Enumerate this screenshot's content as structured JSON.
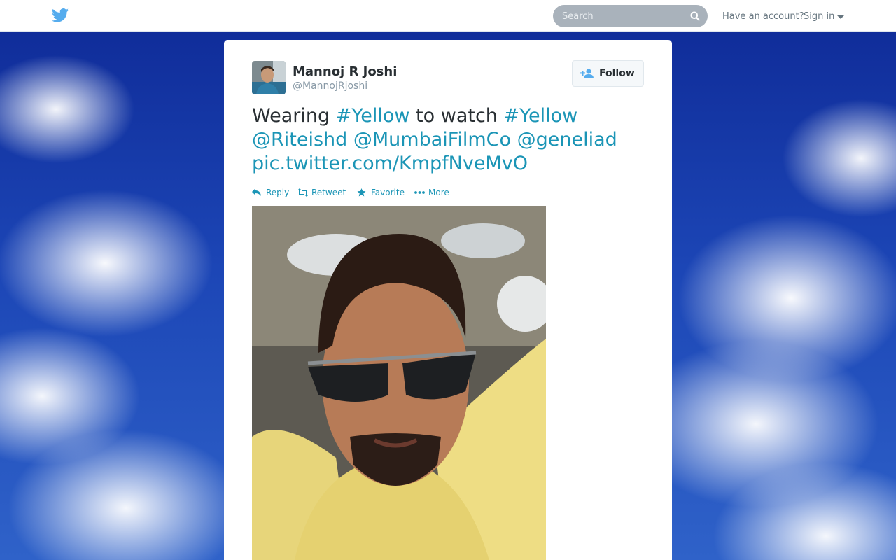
{
  "topbar": {
    "search_placeholder": "Search",
    "have_account": "Have an account?",
    "sign_in": "Sign in"
  },
  "tweet": {
    "author_name": "Mannoj R Joshi",
    "author_handle": "@MannojRjoshi",
    "follow_label": "Follow",
    "text_segments": [
      {
        "text": "Wearing ",
        "link": false
      },
      {
        "text": "#Yellow",
        "link": true
      },
      {
        "text": " to watch ",
        "link": false
      },
      {
        "text": "#Yellow",
        "link": true
      },
      {
        "text": " ",
        "link": false
      },
      {
        "text": "@Riteishd",
        "link": true
      },
      {
        "text": " ",
        "link": false
      },
      {
        "text": "@MumbaiFilmCo",
        "link": true
      },
      {
        "text": " ",
        "link": false
      },
      {
        "text": "@geneliad",
        "link": true
      },
      {
        "text": " ",
        "link": false
      },
      {
        "text": "pic.twitter.com/KmpfNveMvO",
        "link": true
      }
    ],
    "actions": {
      "reply": "Reply",
      "retweet": "Retweet",
      "favorite": "Favorite",
      "more": "More"
    }
  },
  "colors": {
    "link": "#1b95b6",
    "brand": "#55acee",
    "background_sky": "#1c46b6"
  },
  "icons": [
    "twitter-bird-icon",
    "search-icon",
    "caret-down-icon",
    "follow-person-icon",
    "reply-icon",
    "retweet-icon",
    "star-icon",
    "more-dots-icon"
  ]
}
